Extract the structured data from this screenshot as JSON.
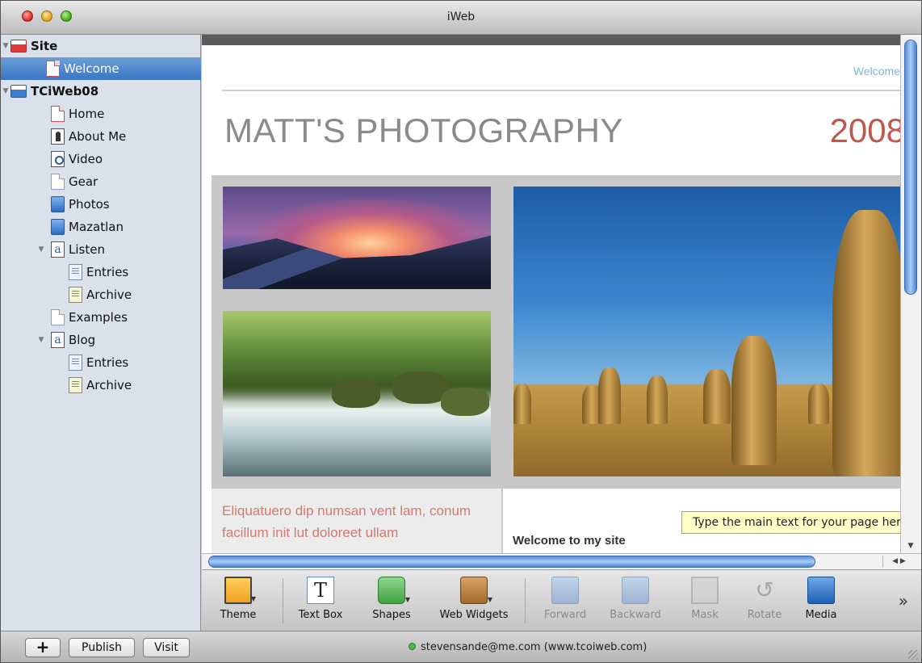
{
  "window": {
    "title": "iWeb"
  },
  "sidebar": {
    "items": [
      {
        "label": "Site",
        "bold": true,
        "icon": "site-icon"
      },
      {
        "label": "Welcome",
        "selected": true,
        "icon": "page-icon"
      },
      {
        "label": "TCiWeb08",
        "bold": true,
        "icon": "site-icon"
      },
      {
        "label": "Home",
        "icon": "page-icon"
      },
      {
        "label": "About Me",
        "icon": "person-icon"
      },
      {
        "label": "Video",
        "icon": "video-icon"
      },
      {
        "label": "Gear",
        "icon": "page-icon"
      },
      {
        "label": "Photos",
        "icon": "photos-icon"
      },
      {
        "label": "Mazatlan",
        "icon": "photos-icon"
      },
      {
        "label": "Listen",
        "icon": "blog-icon"
      },
      {
        "label": "Entries",
        "icon": "entries-icon"
      },
      {
        "label": "Archive",
        "icon": "archive-icon"
      },
      {
        "label": "Examples",
        "icon": "page-icon"
      },
      {
        "label": "Blog",
        "icon": "blog-icon"
      },
      {
        "label": "Entries",
        "icon": "entries-icon"
      },
      {
        "label": "Archive",
        "icon": "archive-icon"
      }
    ]
  },
  "page": {
    "nav_link": "Welcome",
    "title": "MATT'S PHOTOGRAPHY",
    "year": "2008",
    "caption_text": "Eliquatuero dip numsan vent lam, conum facillum init lut doloreet ullam",
    "main_heading": "Welcome to my site",
    "tooltip": "Type the main text for your page here"
  },
  "toolbar": {
    "theme": "Theme",
    "text_box": "Text Box",
    "shapes": "Shapes",
    "web_widgets": "Web Widgets",
    "forward": "Forward",
    "backward": "Backward",
    "mask": "Mask",
    "rotate": "Rotate",
    "media": "Media",
    "overflow": "»"
  },
  "bottombar": {
    "add": "+",
    "publish": "Publish",
    "visit": "Visit",
    "status": "stevensande@me.com (www.tcoiweb.com)"
  },
  "colors": {
    "selection": "#3a75c4",
    "title_gray": "#8a8a8a",
    "accent_red": "#c0574c",
    "nav_blue": "#7fb6d6"
  }
}
